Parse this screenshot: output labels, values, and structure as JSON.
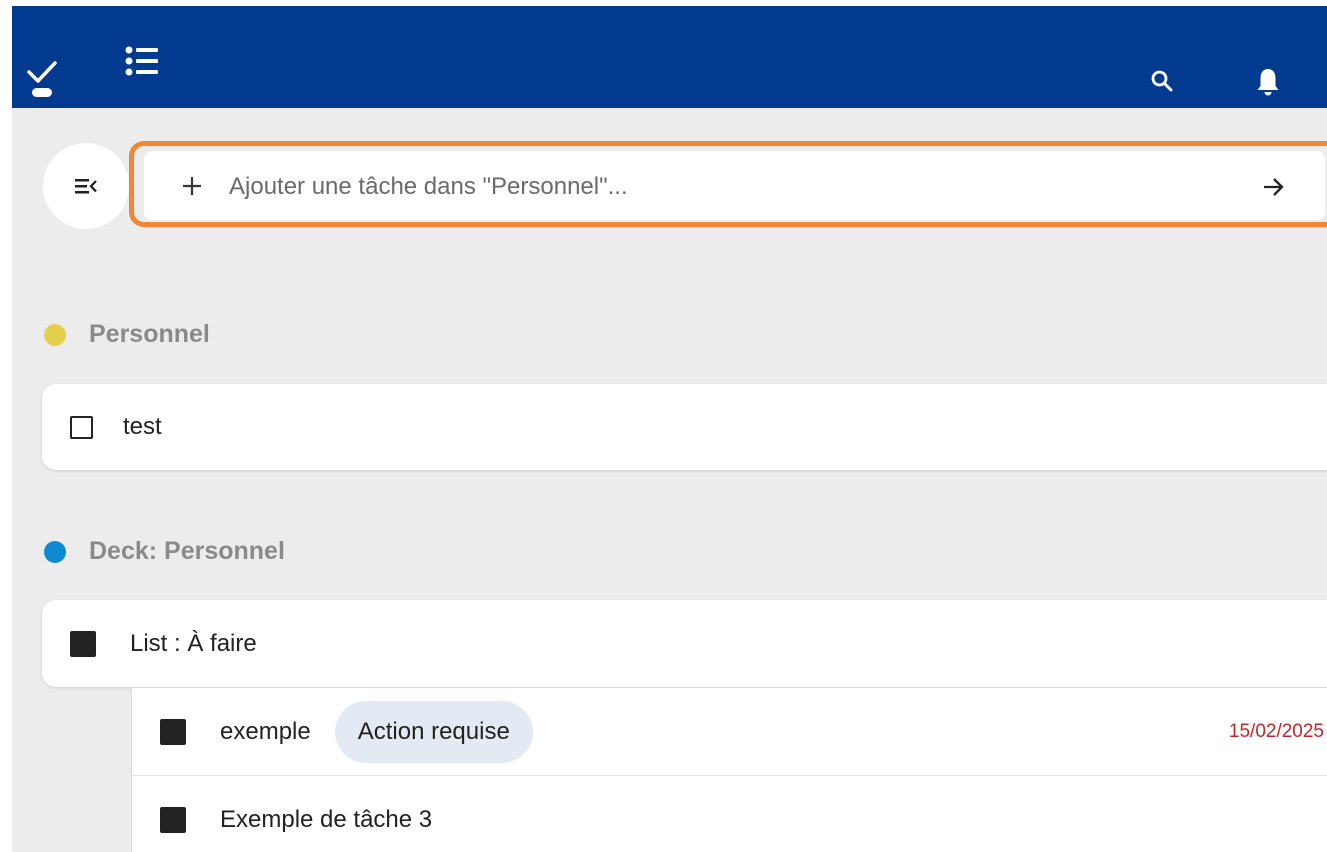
{
  "colors": {
    "topbar": "#023a8f",
    "focus_ring": "#ef8737",
    "personnel_dot": "#e2cf4b",
    "deck_dot": "#0e8ad1",
    "due_date": "#c0272d"
  },
  "topbar": {
    "icons": [
      "check-icon",
      "list-icon",
      "search-icon",
      "bell-icon"
    ]
  },
  "add_task": {
    "placeholder": "Ajouter une tâche dans \"Personnel\"..."
  },
  "sections": [
    {
      "title": "Personnel",
      "tasks": [
        {
          "text": "test",
          "checkbox": "unchecked"
        }
      ]
    },
    {
      "title": "Deck: Personnel",
      "tasks": [
        {
          "text": "List : À faire",
          "subtasks": [
            {
              "text": "exemple",
              "tag": "Action requise",
              "due": "15/02/2025"
            },
            {
              "text": "Exemple de tâche 3"
            }
          ]
        }
      ]
    }
  ]
}
